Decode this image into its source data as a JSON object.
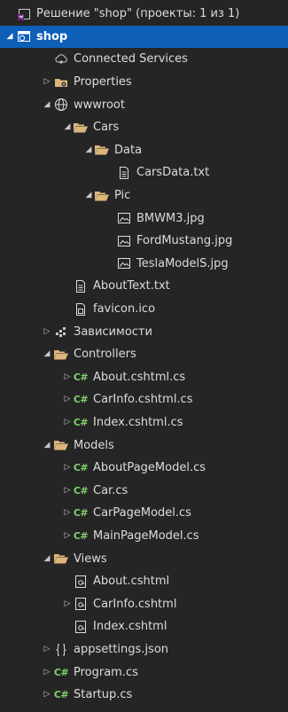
{
  "solution_explorer": {
    "items": [
      {
        "label": "Решение \"shop\" (проекты: 1 из 1)",
        "icon": "solution-icon",
        "level": 0,
        "expander": "none",
        "selected": false
      },
      {
        "label": "shop",
        "icon": "web-project-icon",
        "level": 0,
        "expander": "expanded",
        "selected": true
      },
      {
        "label": "Connected Services",
        "icon": "connected-services-icon",
        "level": 1,
        "expander": "none",
        "selected": false
      },
      {
        "label": "Properties",
        "icon": "properties-folder-icon",
        "level": 1,
        "expander": "collapsed",
        "selected": false
      },
      {
        "label": "wwwroot",
        "icon": "globe-icon",
        "level": 1,
        "expander": "expanded",
        "selected": false
      },
      {
        "label": "Cars",
        "icon": "folder-open-icon",
        "level": 2,
        "expander": "expanded",
        "selected": false
      },
      {
        "label": "Data",
        "icon": "folder-open-icon",
        "level": 3,
        "expander": "expanded",
        "selected": false
      },
      {
        "label": "CarsData.txt",
        "icon": "text-file-icon",
        "level": 4,
        "expander": "none",
        "selected": false
      },
      {
        "label": "Pic",
        "icon": "folder-open-icon",
        "level": 3,
        "expander": "expanded",
        "selected": false
      },
      {
        "label": "BMWM3.jpg",
        "icon": "image-file-icon",
        "level": 4,
        "expander": "none",
        "selected": false
      },
      {
        "label": "FordMustang.jpg",
        "icon": "image-file-icon",
        "level": 4,
        "expander": "none",
        "selected": false
      },
      {
        "label": "TeslaModelS.jpg",
        "icon": "image-file-icon",
        "level": 4,
        "expander": "none",
        "selected": false
      },
      {
        "label": "AboutText.txt",
        "icon": "text-file-icon",
        "level": 2,
        "expander": "none",
        "selected": false
      },
      {
        "label": "favicon.ico",
        "icon": "ico-file-icon",
        "level": 2,
        "expander": "none",
        "selected": false
      },
      {
        "label": "Зависимости",
        "icon": "dependencies-icon",
        "level": 1,
        "expander": "collapsed",
        "selected": false
      },
      {
        "label": "Controllers",
        "icon": "folder-open-icon",
        "level": 1,
        "expander": "expanded",
        "selected": false
      },
      {
        "label": "About.cshtml.cs",
        "icon": "csharp-file-icon",
        "level": 2,
        "expander": "collapsed",
        "selected": false
      },
      {
        "label": "CarInfo.cshtml.cs",
        "icon": "csharp-file-icon",
        "level": 2,
        "expander": "collapsed",
        "selected": false
      },
      {
        "label": "Index.cshtml.cs",
        "icon": "csharp-file-icon",
        "level": 2,
        "expander": "collapsed",
        "selected": false
      },
      {
        "label": "Models",
        "icon": "folder-open-icon",
        "level": 1,
        "expander": "expanded",
        "selected": false
      },
      {
        "label": "AboutPageModel.cs",
        "icon": "csharp-file-icon",
        "level": 2,
        "expander": "collapsed",
        "selected": false
      },
      {
        "label": "Car.cs",
        "icon": "csharp-file-icon",
        "level": 2,
        "expander": "collapsed",
        "selected": false
      },
      {
        "label": "CarPageModel.cs",
        "icon": "csharp-file-icon",
        "level": 2,
        "expander": "collapsed",
        "selected": false
      },
      {
        "label": "MainPageModel.cs",
        "icon": "csharp-file-icon",
        "level": 2,
        "expander": "collapsed",
        "selected": false
      },
      {
        "label": "Views",
        "icon": "folder-open-icon",
        "level": 1,
        "expander": "expanded",
        "selected": false
      },
      {
        "label": "About.cshtml",
        "icon": "razor-file-icon",
        "level": 2,
        "expander": "none",
        "selected": false
      },
      {
        "label": "CarInfo.cshtml",
        "icon": "razor-file-icon",
        "level": 2,
        "expander": "collapsed",
        "selected": false
      },
      {
        "label": "Index.cshtml",
        "icon": "razor-file-icon",
        "level": 2,
        "expander": "none",
        "selected": false
      },
      {
        "label": "appsettings.json",
        "icon": "json-file-icon",
        "level": 1,
        "expander": "collapsed",
        "selected": false
      },
      {
        "label": "Program.cs",
        "icon": "csharp-file-icon",
        "level": 1,
        "expander": "collapsed",
        "selected": false
      },
      {
        "label": "Startup.cs",
        "icon": "csharp-file-icon",
        "level": 1,
        "expander": "collapsed",
        "selected": false
      }
    ]
  },
  "colors": {
    "background": "#252526",
    "selected": "#0e5fb8",
    "folder": "#dcb67a",
    "csharp": "#7fd36b",
    "text": "#dcdcdc"
  }
}
